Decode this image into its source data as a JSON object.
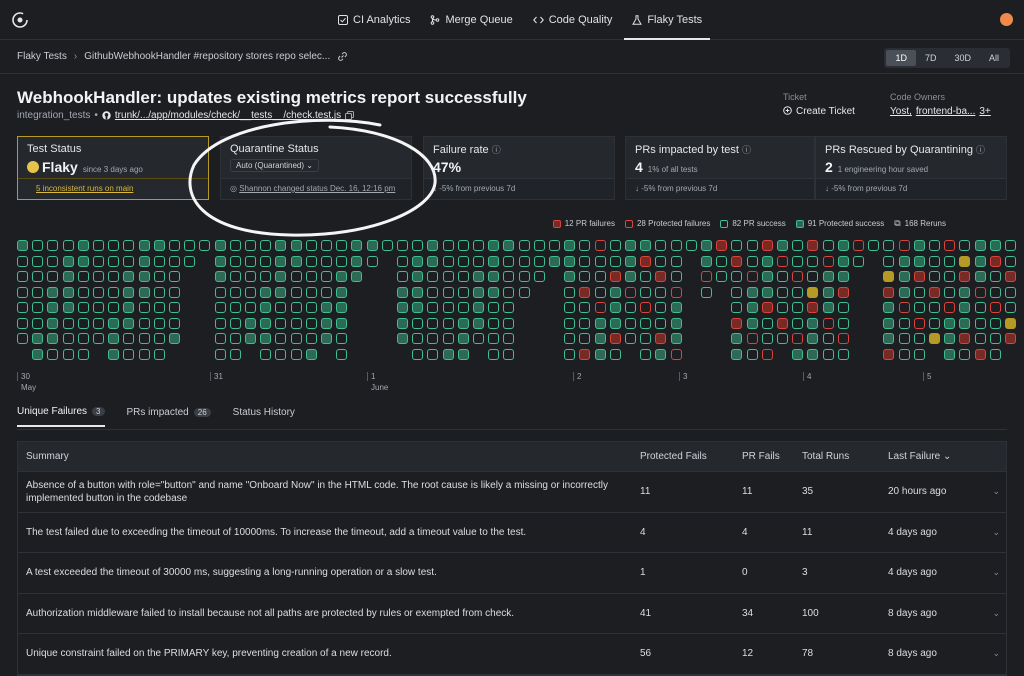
{
  "nav": {
    "tabs": [
      {
        "label": "CI Analytics",
        "icon": "check-square-icon"
      },
      {
        "label": "Merge Queue",
        "icon": "merge-icon"
      },
      {
        "label": "Code Quality",
        "icon": "code-icon"
      },
      {
        "label": "Flaky Tests",
        "icon": "flask-icon",
        "active": true
      }
    ]
  },
  "breadcrumb": {
    "root": "Flaky Tests",
    "current": "GithubWebhookHandler #repository stores repo selec..."
  },
  "range": {
    "options": [
      "1D",
      "7D",
      "30D",
      "All"
    ],
    "selected": "1D"
  },
  "test": {
    "title": "WebhookHandler: updates existing metrics report successfully",
    "suite": "integration_tests",
    "path": "trunk/.../app/modules/check/__tests__/check.test.js"
  },
  "ticket": {
    "label": "Ticket",
    "action": "Create Ticket"
  },
  "owners": {
    "label": "Code Owners",
    "values": [
      "Yost,",
      "frontend-ba...",
      "3+"
    ]
  },
  "cards": {
    "status": {
      "title": "Test Status",
      "value": "Flaky",
      "since": "since 3 days ago",
      "footer": "5 inconsistent runs on main"
    },
    "quarantine": {
      "title": "Quarantine Status",
      "select": "Auto (Quarantined)",
      "footer": "Shannon changed status Dec. 16, 12:16 pm"
    },
    "failure": {
      "title": "Failure rate",
      "value": "47%",
      "footer": "-5% from previous 7d"
    },
    "prs": {
      "title": "PRs impacted by test",
      "value": "4",
      "note": "1% of all tests",
      "footer": "-5% from previous 7d"
    },
    "rescued": {
      "title": "PRs Rescued by Quarantining",
      "value": "2",
      "note": "1 engineering hour saved",
      "footer": "-5% from previous 7d"
    }
  },
  "legend": [
    {
      "label": "12 PR failures",
      "color": "#d9453b",
      "style": "pr-fail"
    },
    {
      "label": "28 Protected failures",
      "color": "#d9453b",
      "style": "prot-fail"
    },
    {
      "label": "82 PR success",
      "color": "#3fbf8f",
      "style": "pr-ok"
    },
    {
      "label": "91 Protected success",
      "color": "#3fbf8f",
      "style": "prot-ok"
    },
    {
      "label": "168 Reruns",
      "color": "#8a8f98",
      "style": "rerun"
    }
  ],
  "axis": [
    {
      "day": "30",
      "month": "May"
    },
    {
      "day": "31",
      "month": ""
    },
    {
      "day": "1",
      "month": "June"
    },
    {
      "day": "2",
      "month": ""
    },
    {
      "day": "3",
      "month": ""
    },
    {
      "day": "4",
      "month": ""
    },
    {
      "day": "5",
      "month": ""
    }
  ],
  "tabs": [
    {
      "label": "Unique Failures",
      "count": "3",
      "active": true
    },
    {
      "label": "PRs impacted",
      "count": "26"
    },
    {
      "label": "Status History",
      "count": ""
    }
  ],
  "table": {
    "headers": [
      "Summary",
      "Protected Fails",
      "PR Fails",
      "Total Runs",
      "Last Failure"
    ],
    "rows": [
      {
        "summary": "Absence of a button with role=\"button\" and name \"Onboard Now\" in the HTML code. The root cause is likely a missing or incorrectly implemented button in the codebase",
        "protected": "11",
        "pr": "11",
        "total": "35",
        "last": "20 hours ago"
      },
      {
        "summary": "The test failed due to exceeding the timeout of 10000ms. To increase the timeout, add a timeout value to the test.",
        "protected": "4",
        "pr": "4",
        "total": "11",
        "last": "4 days ago"
      },
      {
        "summary": "A test exceeded the timeout of 30000 ms, suggesting a long-running operation or a slow test.",
        "protected": "1",
        "pr": "0",
        "total": "3",
        "last": "4 days ago"
      },
      {
        "summary": "Authorization middleware failed to install because not all paths are protected by rules or exempted from check.",
        "protected": "41",
        "pr": "34",
        "total": "100",
        "last": "8 days ago"
      },
      {
        "summary": "Unique constraint failed on the PRIMARY key, preventing creation of a new record.",
        "protected": "56",
        "pr": "12",
        "total": "78",
        "last": "8 days ago"
      }
    ]
  }
}
